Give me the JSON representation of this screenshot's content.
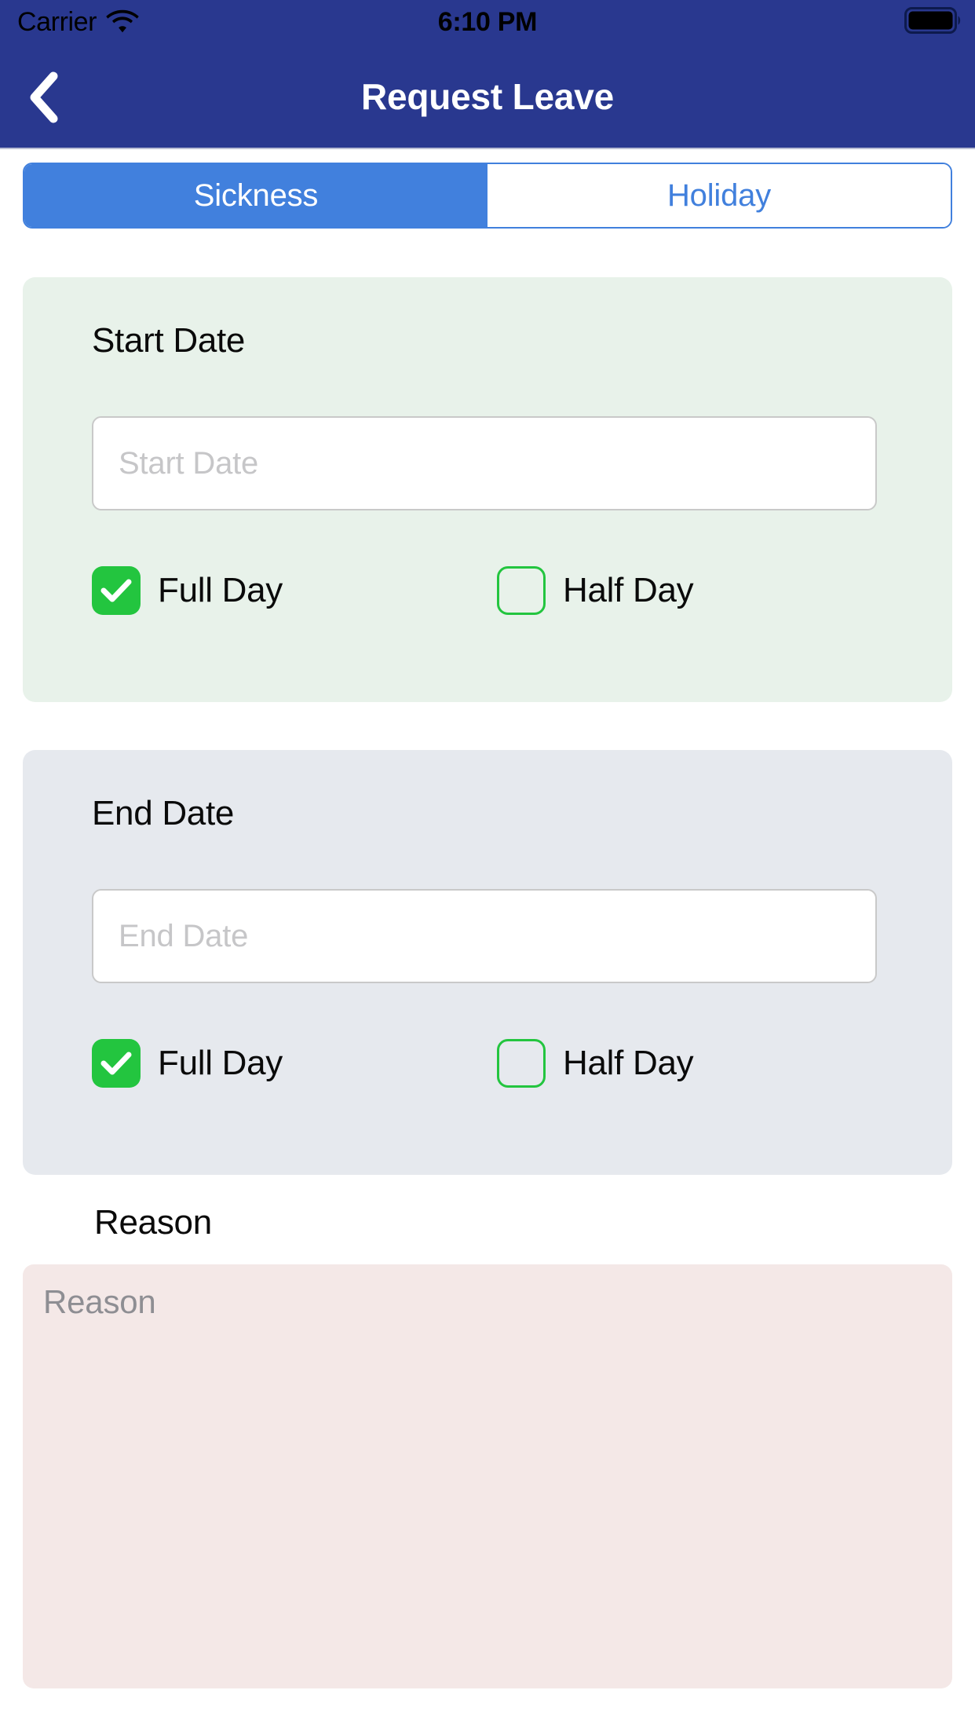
{
  "status_bar": {
    "carrier": "Carrier",
    "wifi_icon": "wifi-icon",
    "time": "6:10 PM",
    "battery_icon": "battery-full-icon"
  },
  "nav_bar": {
    "back_icon": "chevron-left-icon",
    "title": "Request Leave",
    "background_color": "#29388f"
  },
  "segmented_control": {
    "selected": "Sickness",
    "accent_color": "#4180dd",
    "options": [
      {
        "label": "Sickness",
        "active": true
      },
      {
        "label": "Holiday",
        "active": false
      }
    ]
  },
  "start_date_card": {
    "title": "Start Date",
    "background_color": "#e8f2ea",
    "input": {
      "value": "",
      "placeholder": "Start Date"
    },
    "options": [
      {
        "label": "Full Day",
        "checked": true
      },
      {
        "label": "Half Day",
        "checked": false
      }
    ],
    "check_color": "#23c53f"
  },
  "end_date_card": {
    "title": "End Date",
    "background_color": "#e6e9ee",
    "input": {
      "value": "",
      "placeholder": "End Date"
    },
    "options": [
      {
        "label": "Full Day",
        "checked": true
      },
      {
        "label": "Half Day",
        "checked": false
      }
    ],
    "check_color": "#23c53f"
  },
  "reason_section": {
    "title": "Reason",
    "background_color": "#f4e8e7",
    "textarea": {
      "value": "",
      "placeholder": "Reason"
    }
  }
}
